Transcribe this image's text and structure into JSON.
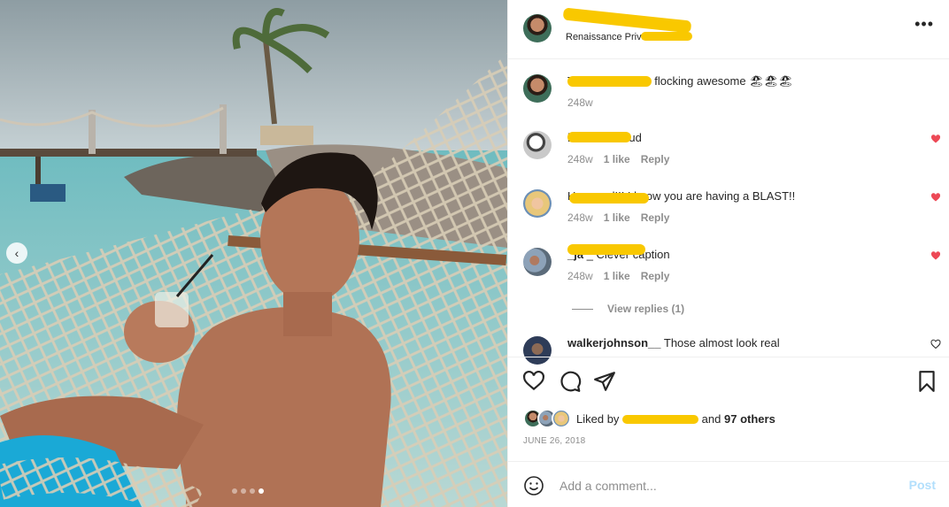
{
  "post": {
    "location": "Renaissance Private Isla",
    "more_icon": "more-horizontal-icon",
    "carousel": {
      "dots": 4,
      "active_index": 3
    }
  },
  "comments": [
    {
      "user": "",
      "text": "The view here is flocking awesome 🏖🏖🏖",
      "time": "248w",
      "likes": "",
      "reply": "",
      "liked": false,
      "avatar": "av-main"
    },
    {
      "user": "brockk",
      "text": "9 Stud",
      "time": "248w",
      "likes": "1 like",
      "reply": "Reply",
      "liked": true,
      "avatar": "av-white"
    },
    {
      "user": "",
      "text": "How cool!!! I know you are having a BLAST!!",
      "time": "248w",
      "likes": "1 like",
      "reply": "Reply",
      "liked": true,
      "avatar": "av-blonde"
    },
    {
      "user": "_ja",
      "text": "_ Clever caption",
      "time": "248w",
      "likes": "1 like",
      "reply": "Reply",
      "liked": true,
      "avatar": "av-group"
    },
    {
      "user": "walkerjohnson__",
      "text": "Those almost look real",
      "time": "",
      "likes": "",
      "reply": "",
      "liked": false,
      "avatar": "av-walker"
    }
  ],
  "view_replies": "View replies (1)",
  "likes": {
    "prefix": "Liked by",
    "suffix": "and",
    "others": "97 others"
  },
  "date": "JUNE 26, 2018",
  "add_comment": {
    "placeholder": "Add a comment...",
    "post_label": "Post"
  },
  "colors": {
    "like_red": "#ed4956",
    "post_blue": "#b2dffc",
    "redaction": "#f9c800"
  }
}
